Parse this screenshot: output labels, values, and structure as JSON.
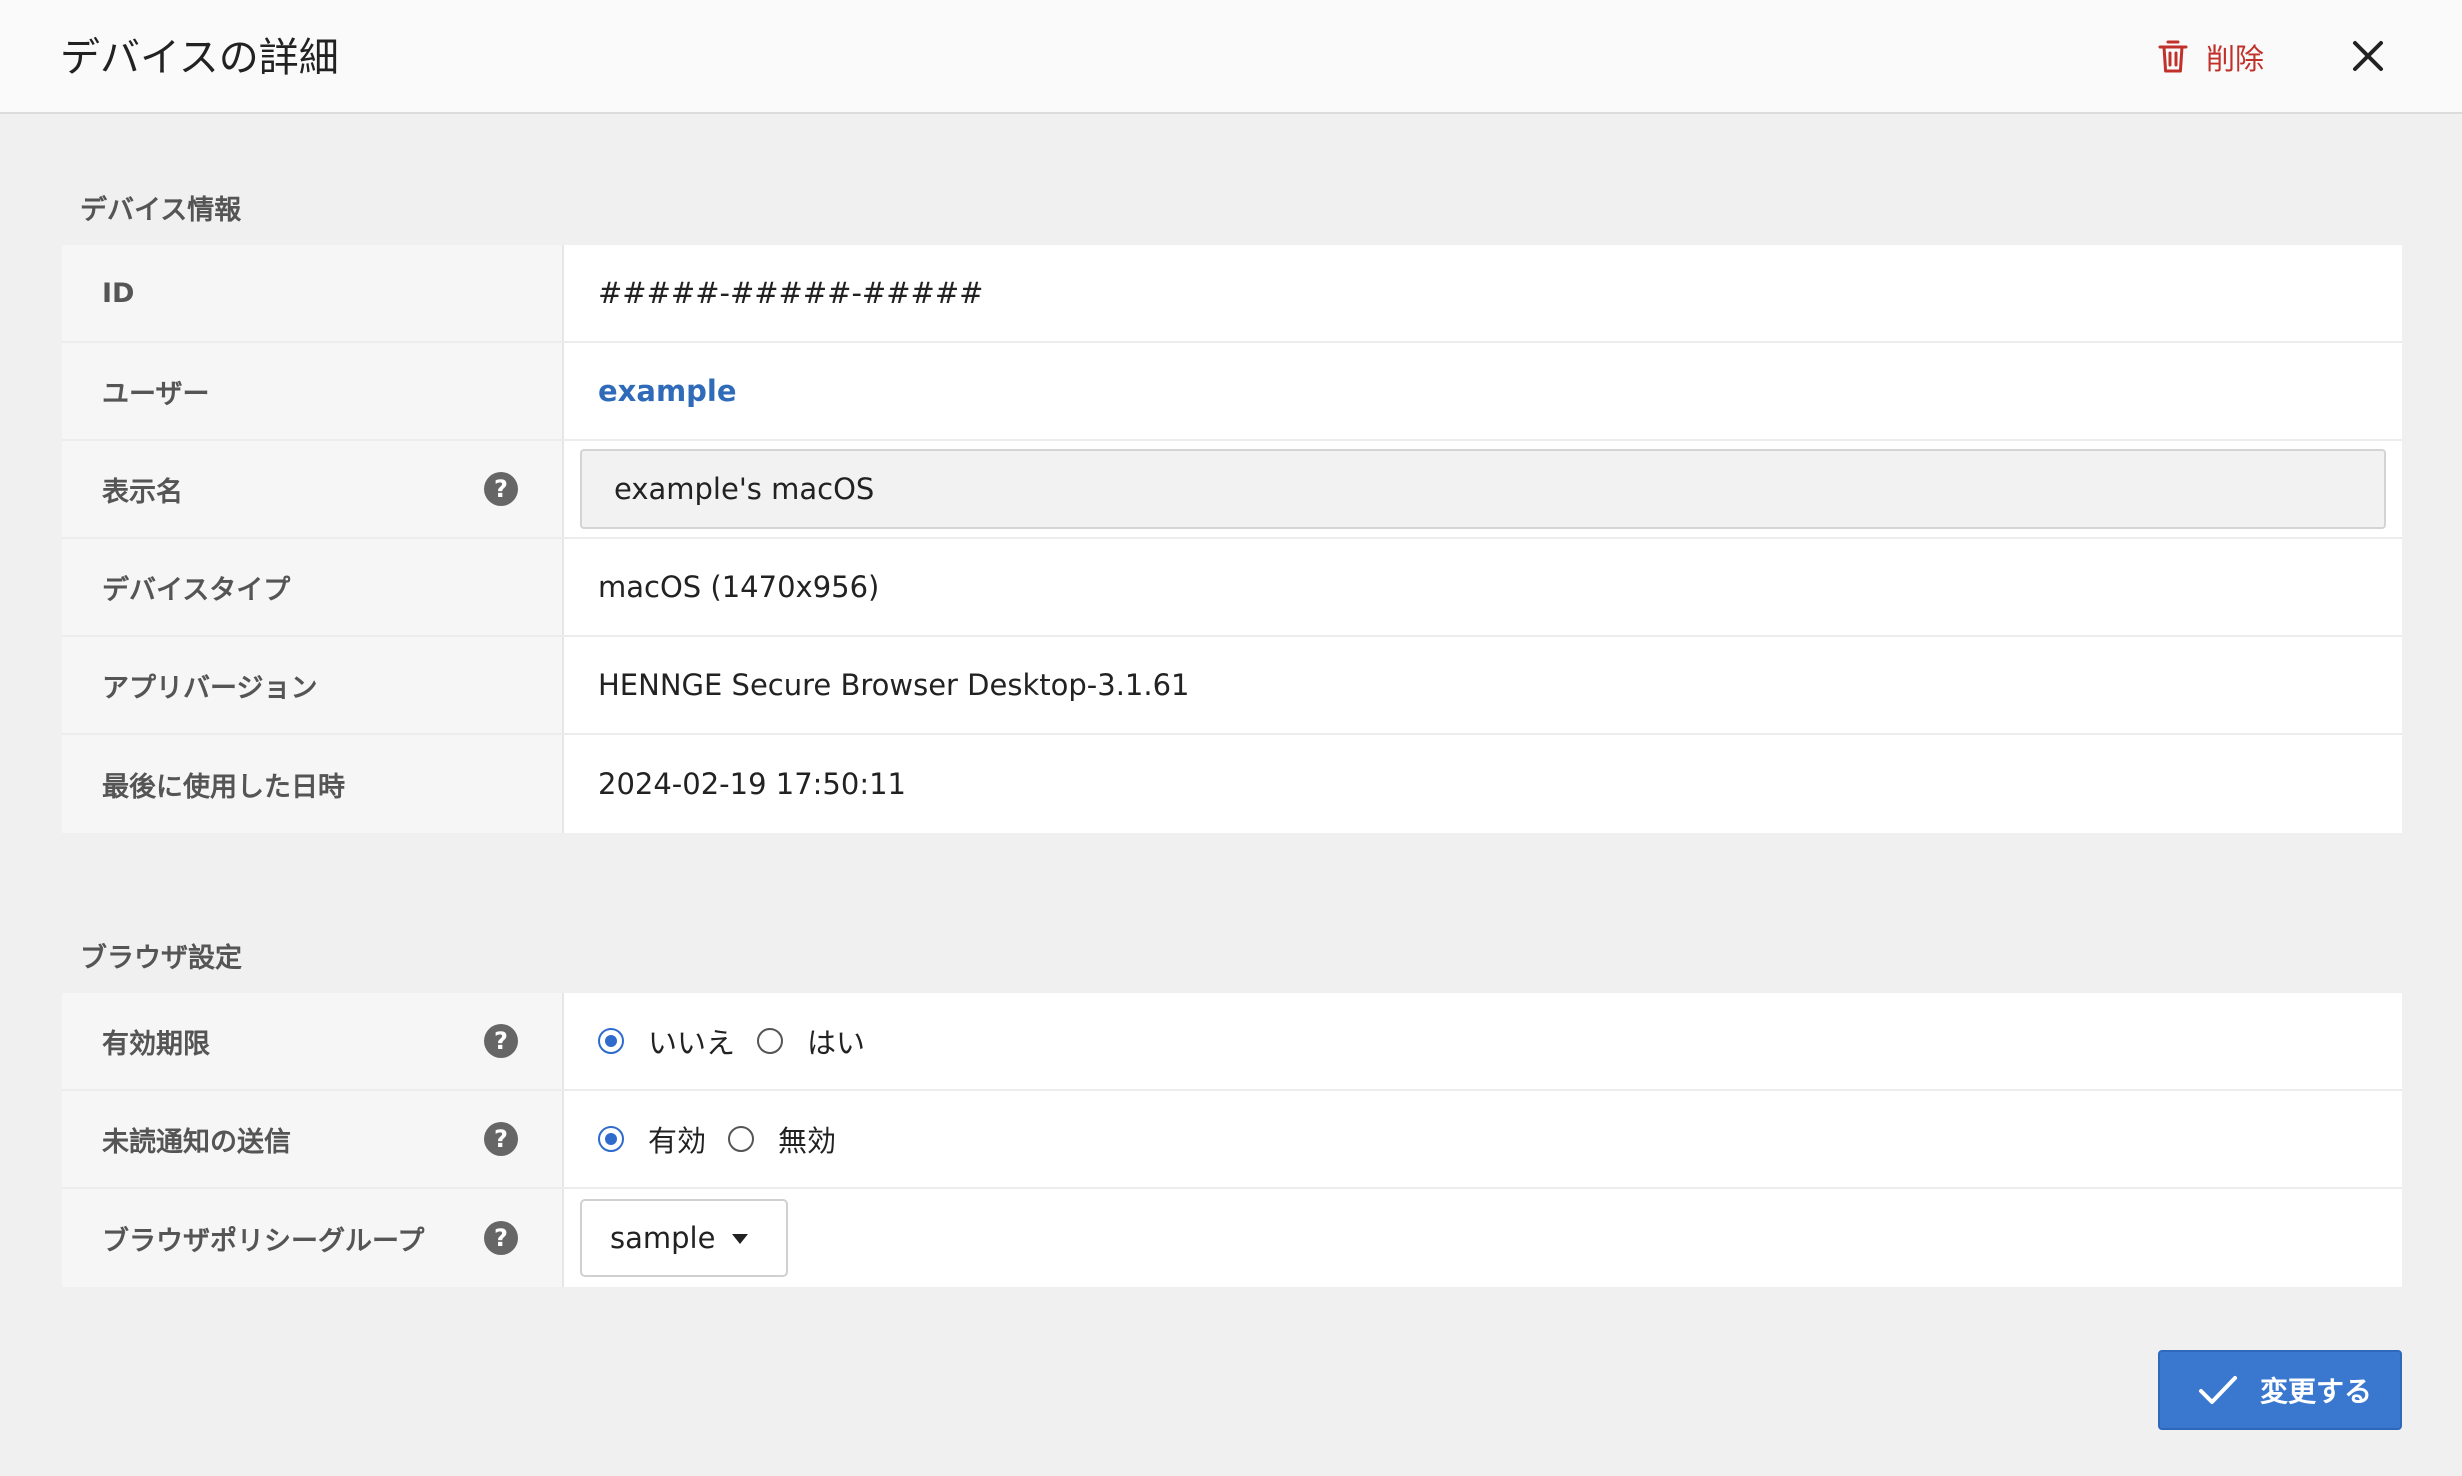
{
  "header": {
    "title": "デバイスの詳細",
    "delete_label": "削除",
    "delete_icon": "trash-icon",
    "close_icon": "close-icon"
  },
  "device_info": {
    "section_title": "デバイス情報",
    "rows": [
      {
        "label": "ID",
        "value": "#####-#####-#####"
      },
      {
        "label": "ユーザー",
        "value": "example"
      },
      {
        "label": "表示名",
        "value": "example's macOS"
      },
      {
        "label": "デバイスタイプ",
        "value": "macOS (1470x956)"
      },
      {
        "label": "アプリバージョン",
        "value": "HENNGE Secure Browser Desktop-3.1.61"
      },
      {
        "label": "最後に使用した日時",
        "value": "2024-02-19 17:50:11"
      }
    ]
  },
  "browser_settings": {
    "section_title": "ブラウザ設定",
    "expiry": {
      "label": "有効期限",
      "options": [
        "いいえ",
        "はい"
      ],
      "selected": "いいえ"
    },
    "unread_notification": {
      "label": "未読通知の送信",
      "options": [
        "有効",
        "無効"
      ],
      "selected": "有効"
    },
    "policy_group": {
      "label": "ブラウザポリシーグループ",
      "selected": "sample"
    }
  },
  "submit_label": "変更する",
  "colors": {
    "accent": "#3a78d0",
    "danger": "#c0312b",
    "link": "#2f6bb8"
  }
}
